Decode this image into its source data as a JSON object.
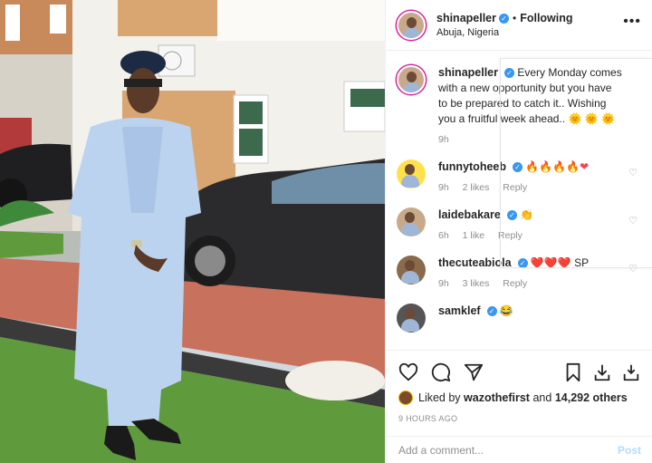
{
  "post": {
    "username": "shinapeller",
    "follow_status": "Following",
    "location": "Abuja, Nigeria",
    "more_label": "•••"
  },
  "caption": {
    "username": "shinapeller",
    "text": "Every Monday comes with a new opportunity but you have to be prepared to catch it.. Wishing you a fruitful week ahead..",
    "emojis": "🌞 🌞 🌞",
    "age": "9h"
  },
  "comments": [
    {
      "username": "funnytoheeb",
      "emojis": "🔥🔥🔥🔥",
      "heart": "❤",
      "age": "9h",
      "likes": "2 likes",
      "reply": "Reply"
    },
    {
      "username": "laidebakare",
      "emojis": "👏",
      "age": "6h",
      "likes": "1 like",
      "reply": "Reply"
    },
    {
      "username": "thecuteabiola",
      "emojis": "❤️❤️❤️",
      "suffix": "SP",
      "age": "9h",
      "likes": "3 likes",
      "reply": "Reply"
    },
    {
      "username": "samklef",
      "emojis": "😂"
    }
  ],
  "likes": {
    "prefix": "Liked by",
    "liker": "wazothefirst",
    "and": "and",
    "count": "14,292 others"
  },
  "timestamp": "9 HOURS AGO",
  "add_comment": {
    "placeholder": "Add a comment...",
    "post_label": "Post"
  },
  "icons": [
    "heart-icon",
    "comment-icon",
    "share-icon",
    "bookmark-icon",
    "download-icon"
  ]
}
